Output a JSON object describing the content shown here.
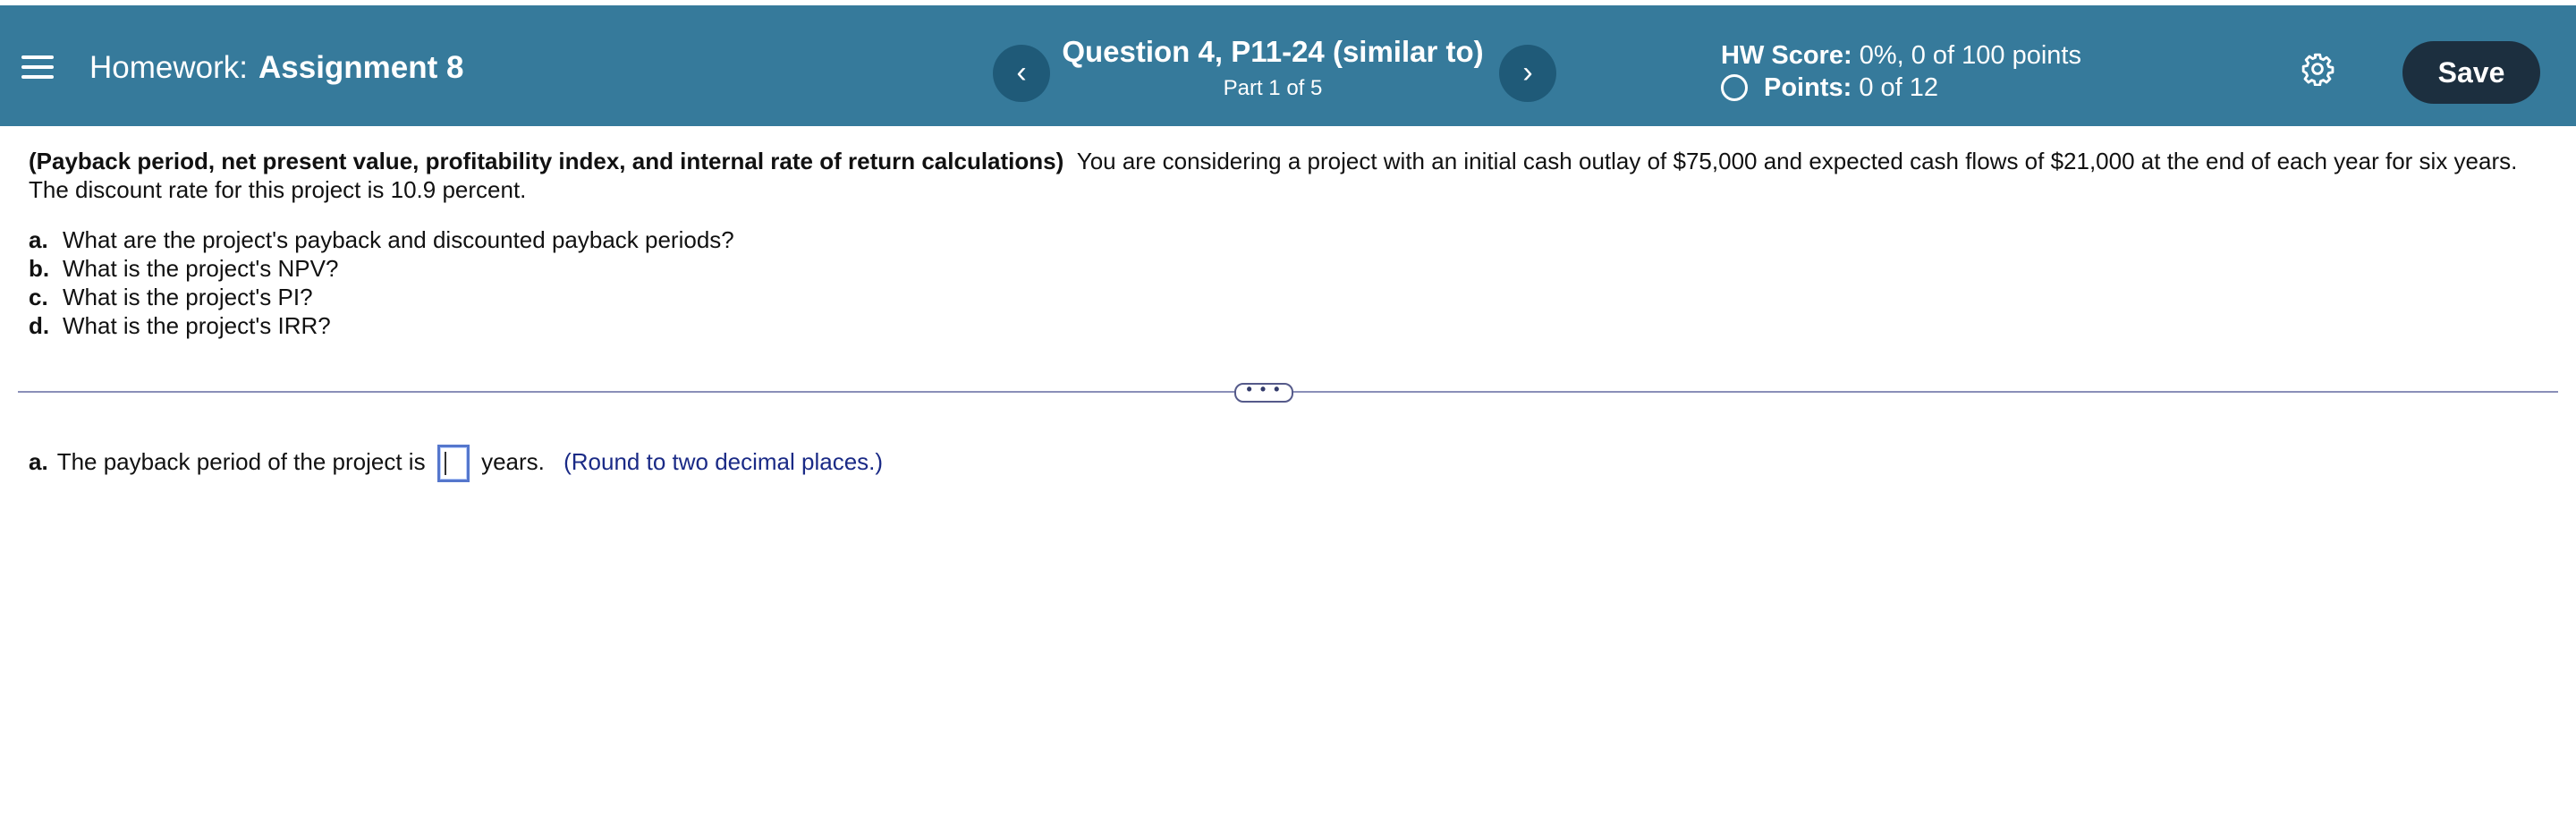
{
  "header": {
    "homework_label": "Homework:",
    "assignment_name": "Assignment 8",
    "question_title": "Question 4, P11-24 (similar to)",
    "part_text": "Part 1 of 5",
    "prev_symbol": "‹",
    "next_symbol": "›",
    "hw_score_label": "HW Score:",
    "hw_score_value": "0%, 0 of 100 points",
    "points_label": "Points:",
    "points_value": "0 of 12",
    "save_label": "Save",
    "bar_color": "#367a9b"
  },
  "problem": {
    "title": "(Payback period, net present value, profitability index, and internal rate of return calculations)",
    "body": "You are considering a project with an initial cash outlay of $75,000 and expected cash flows of $21,000 at the end of each year for six years. The discount rate for this project is 10.9 percent.",
    "parts": [
      {
        "letter": "a.",
        "text": "What are the project's payback and discounted payback periods?"
      },
      {
        "letter": "b.",
        "text": "What is the project's NPV?"
      },
      {
        "letter": "c.",
        "text": "What is the project's PI?"
      },
      {
        "letter": "d.",
        "text": "What is the project's IRR?"
      }
    ]
  },
  "divider": {
    "expander_text": "• • •"
  },
  "answer": {
    "letter": "a.",
    "prefix": "The payback period of the project is",
    "input_value": "",
    "suffix": "years.",
    "hint": "(Round to two decimal places.)"
  }
}
